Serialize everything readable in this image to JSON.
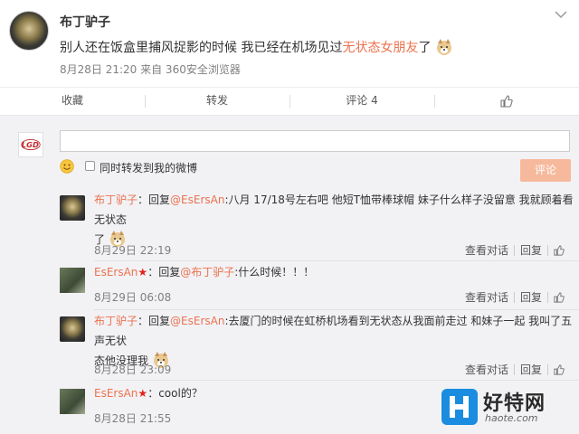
{
  "post": {
    "username": "布丁驴子",
    "text_prefix": "别人还在饭盒里捕风捉影的时候 我已经在机场见过",
    "text_highlight": "无状态女朋友",
    "text_suffix": "了",
    "meta": "8月28日 21:20 来自 360安全浏览器"
  },
  "actions": {
    "favorite": "收藏",
    "repost": "转发",
    "comment": "评论 4"
  },
  "composer": {
    "input_value": "",
    "repost_checkbox_label": "同时转发到我的微博",
    "submit_label": "评论",
    "repost_checked": false
  },
  "comments": [
    {
      "user": "布丁驴子",
      "reply_prefix": "：回复",
      "mention": "@EsErsAn",
      "text_line1": ":八月 17/18号左右吧 他短T恤带棒球帽 妹子什么样子没留意 我就顾着看无状态",
      "text_line2": "了",
      "time": "8月29日 22:19",
      "act_view": "查看对话",
      "act_reply": "回复"
    },
    {
      "user": "EsErsAn",
      "reply_prefix": "：回复",
      "mention": "@布丁驴子",
      "text_line1": ":什么时候！！！",
      "text_line2": "",
      "time": "8月29日 06:08",
      "act_view": "查看对话",
      "act_reply": "回复"
    },
    {
      "user": "布丁驴子",
      "reply_prefix": "：回复",
      "mention": "@EsErsAn",
      "text_line1": ":去厦门的时候在虹桥机场看到无状态从我面前走过 和妹子一起 我叫了五声无状",
      "text_line2": "态他没理我",
      "time": "8月28日 23:09",
      "act_view": "查看对话",
      "act_reply": "回复"
    },
    {
      "user": "EsErsAn",
      "reply_prefix": "：",
      "mention": "",
      "text_line1": "cool的？",
      "text_line2": "",
      "time": "8月28日 21:55",
      "act_view": "",
      "act_reply": ""
    }
  ],
  "watermark": {
    "brand": "好特网",
    "url": "haote.com",
    "color": "#1a8de0"
  },
  "colors": {
    "accent": "#eb7350",
    "button_disabled": "#f7b99c"
  }
}
